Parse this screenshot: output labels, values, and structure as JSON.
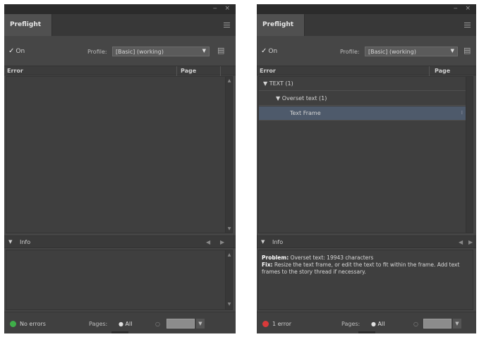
{
  "colors": {
    "panel_bg": "#464646",
    "list_bg": "#3f3f3f",
    "selected_row": "#4e5a6b",
    "no_errors_dot": "#3fae49",
    "error_dot": "#d93a3a"
  },
  "left": {
    "tab_label": "Preflight",
    "on_label": "On",
    "profile_label": "Profile:",
    "profile_value": "[Basic] (working)",
    "col_error": "Error",
    "col_page": "Page",
    "info_label": "Info",
    "status_text": "No errors",
    "pages_label": "Pages:",
    "all_label": "All"
  },
  "right": {
    "tab_label": "Preflight",
    "on_label": "On",
    "profile_label": "Profile:",
    "profile_value": "[Basic] (working)",
    "col_error": "Error",
    "col_page": "Page",
    "tree": [
      {
        "label": "TEXT (1)",
        "arrow": "▼"
      },
      {
        "label": "Overset text (1)",
        "arrow": "▼"
      },
      {
        "label": "Text Frame",
        "arrow": ""
      }
    ],
    "info_label": "Info",
    "problem_label": "Problem:",
    "problem_text": " Overset text: 19943 characters",
    "fix_label": "Fix:",
    "fix_text": " Resize the text frame, or edit the text to fit within the frame. Add text frames to the story thread if necessary.",
    "status_text": "1 error",
    "pages_label": "Pages:",
    "all_label": "All"
  },
  "icons": [
    "checkmark-icon",
    "dropdown-arrow-icon",
    "profiles-icon",
    "panel-menu-icon",
    "disclosure-triangle-icon",
    "status-dot-icon"
  ]
}
